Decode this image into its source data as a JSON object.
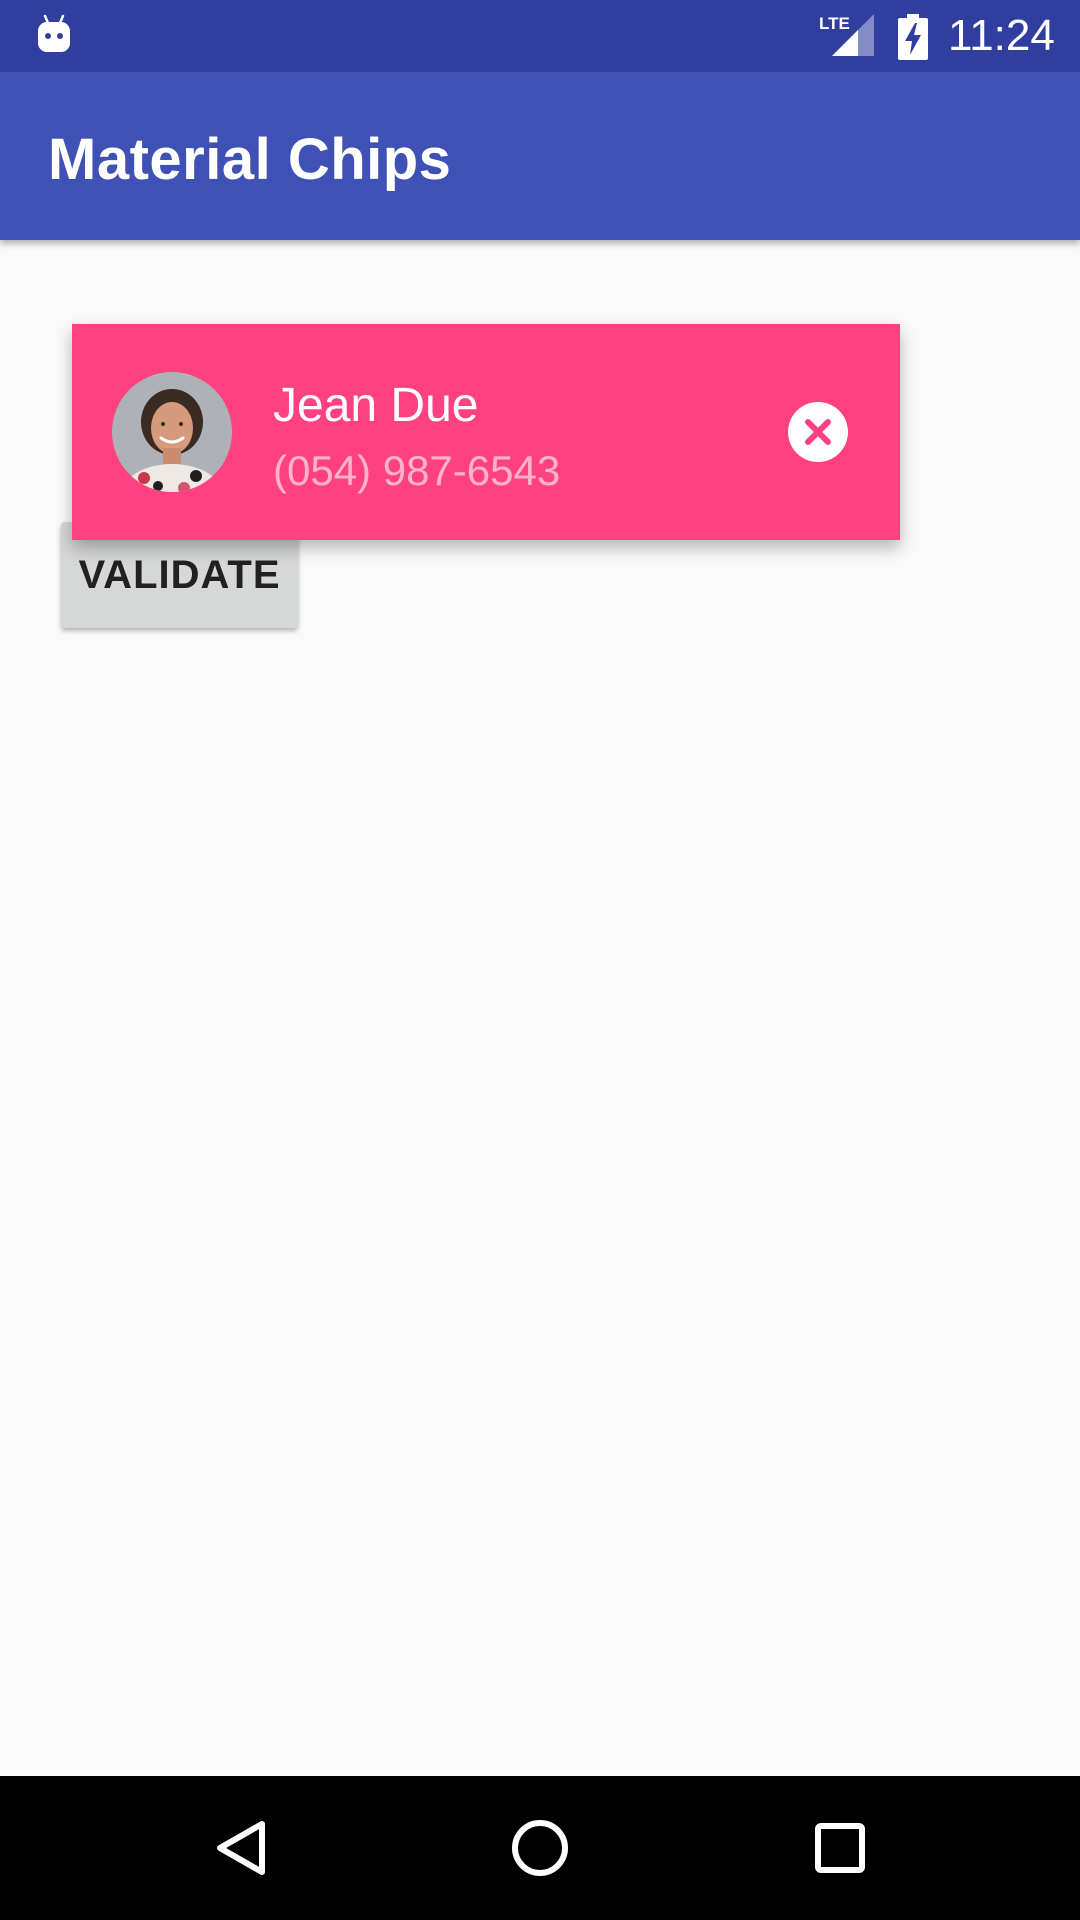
{
  "status_bar": {
    "time": "11:24",
    "network": "LTE",
    "icons": [
      "android-icon",
      "lte-signal-icon",
      "battery-charging-icon"
    ]
  },
  "app_bar": {
    "title": "Material Chips"
  },
  "chip": {
    "name": "Jean Due",
    "phone": "(054) 987-6543",
    "avatar_icon": "person-avatar",
    "delete_icon": "close-circle-icon"
  },
  "actions": {
    "validate_label": "VALIDATE"
  },
  "nav_bar": {
    "icons": [
      "back-icon",
      "home-icon",
      "recents-icon"
    ]
  },
  "colors": {
    "status_bar": "#303f9f",
    "app_bar": "#3f51b5",
    "chip_background": "#ff4081",
    "button_background": "#d6d7d7",
    "page_background": "#fafafa"
  }
}
